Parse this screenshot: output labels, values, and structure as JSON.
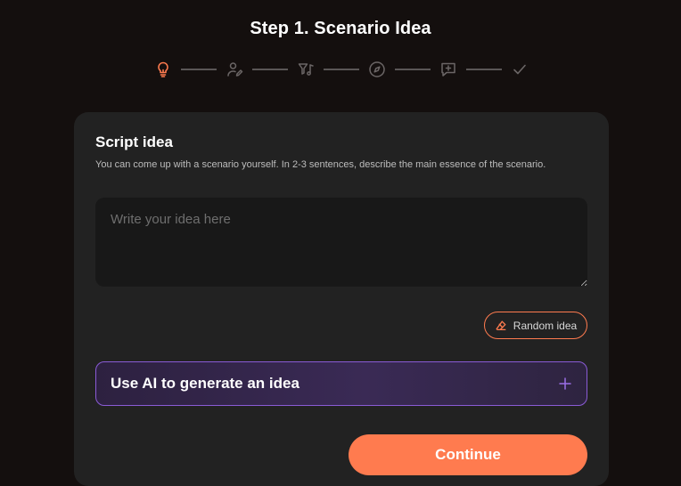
{
  "header": {
    "title": "Step 1. Scenario Idea"
  },
  "stepper": {
    "active_color": "#ff7b4f",
    "inactive_color": "#6b6666",
    "steps": [
      {
        "icon": "lightbulb-icon",
        "active": true
      },
      {
        "icon": "user-edit-icon",
        "active": false
      },
      {
        "icon": "filter-music-icon",
        "active": false
      },
      {
        "icon": "compass-icon",
        "active": false
      },
      {
        "icon": "message-plus-icon",
        "active": false
      },
      {
        "icon": "checkmark-icon",
        "active": false
      }
    ]
  },
  "script_idea": {
    "title": "Script idea",
    "description": "You can come up with a scenario yourself. In 2-3 sentences, describe the main essence of the scenario.",
    "input_value": "",
    "input_placeholder": "Write your idea here",
    "random_button_label": "Random idea"
  },
  "ai_panel": {
    "label": "Use AI to generate an idea",
    "expand_icon": "plus-icon",
    "accent_color": "#8a5bd6"
  },
  "actions": {
    "continue_label": "Continue",
    "accent_color": "#ff7b4f"
  }
}
